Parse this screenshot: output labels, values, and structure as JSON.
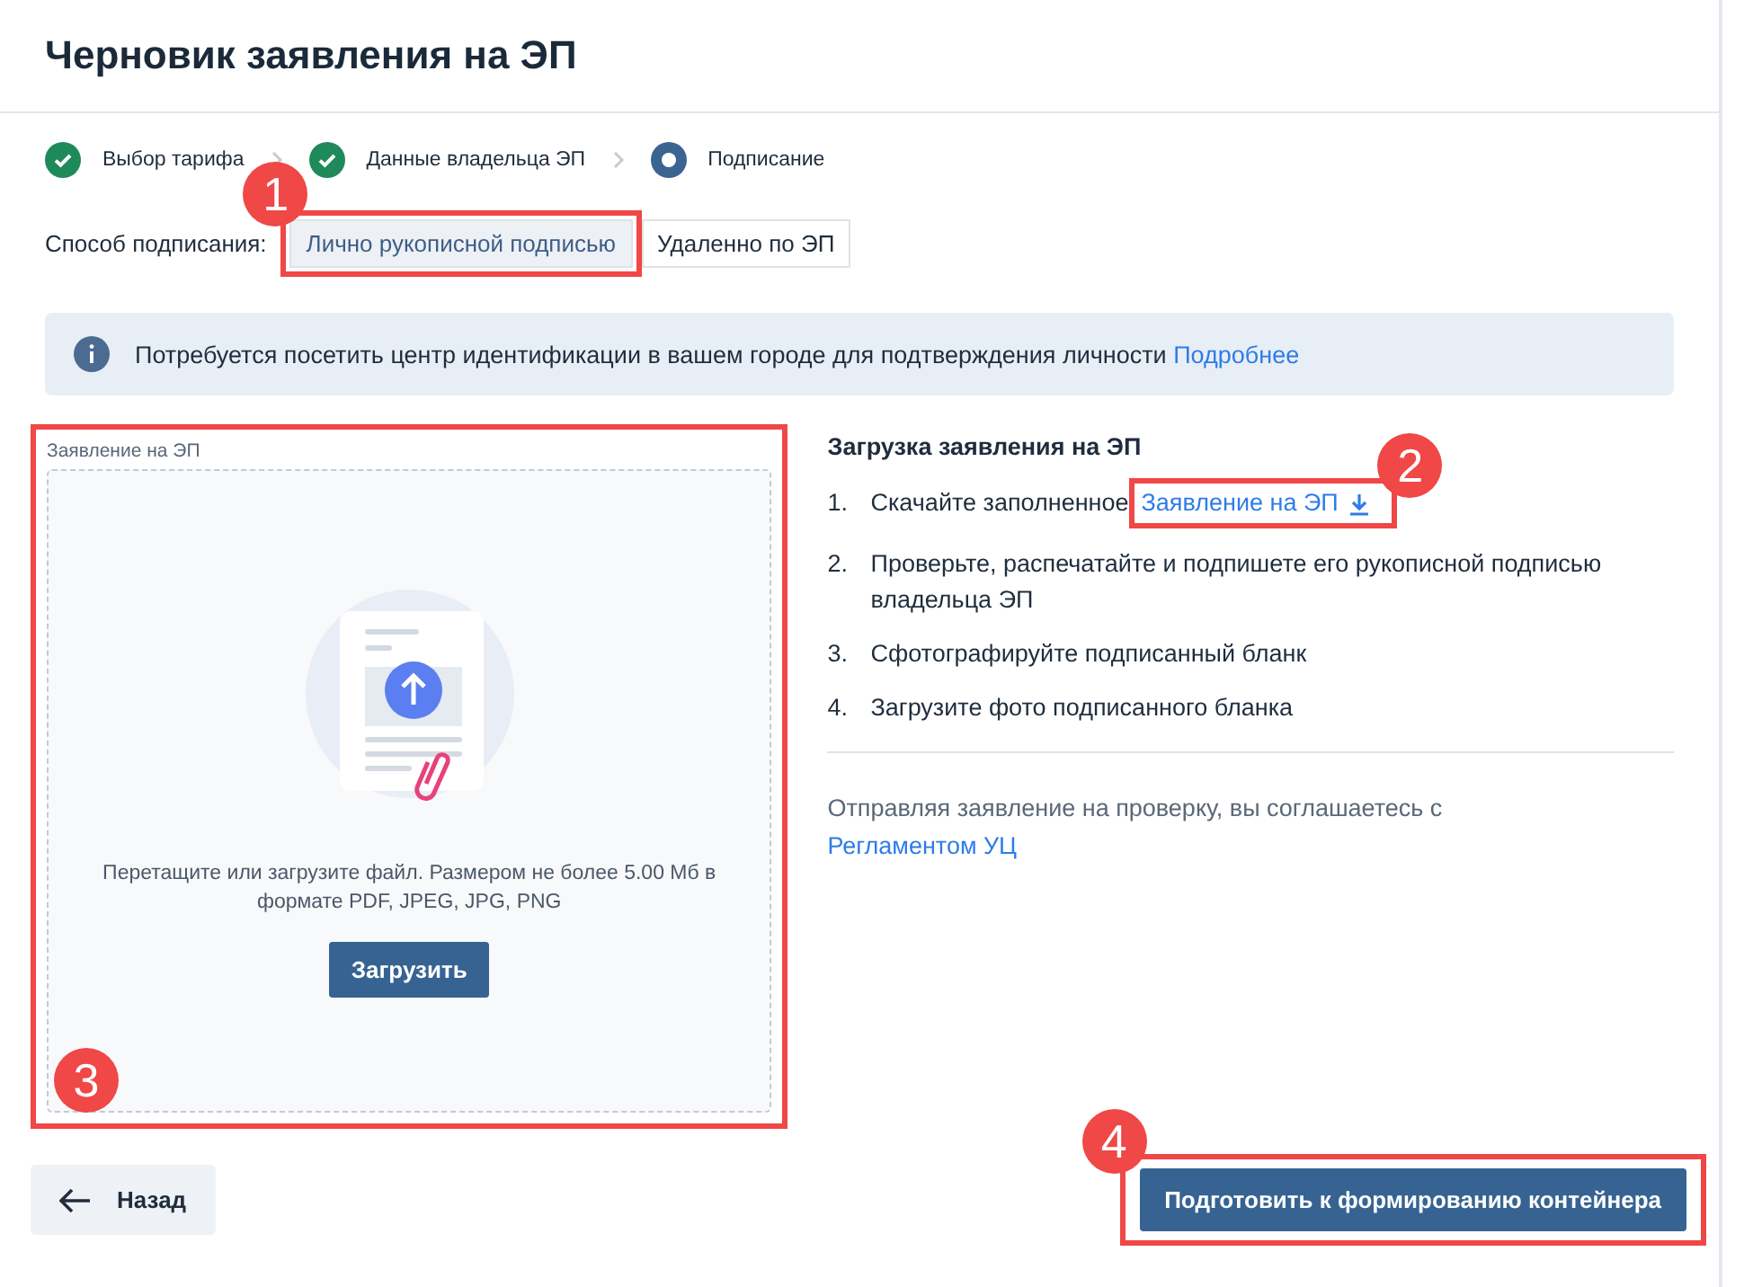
{
  "title": "Черновик заявления на ЭП",
  "steps": [
    {
      "label": "Выбор тарифа",
      "completed": true
    },
    {
      "label": "Данные владельца ЭП",
      "completed": true
    },
    {
      "label": "Подписание",
      "completed": false
    }
  ],
  "signing_method": {
    "label": "Способ подписания:",
    "callout": "1",
    "options": [
      {
        "label": "Лично рукописной подписью",
        "selected": true
      },
      {
        "label": "Удаленно по ЭП",
        "selected": false
      }
    ]
  },
  "info_banner": {
    "text": "Потребуется посетить центр идентификации в вашем городе для подтверждения личности",
    "link": "Подробнее"
  },
  "upload": {
    "label": "Заявление на ЭП",
    "callout": "3",
    "hint": "Перетащите или загрузите файл. Размером не более 5.00 Мб в формате PDF, JPEG, JPG, PNG",
    "button": "Загрузить"
  },
  "instructions": {
    "title": "Загрузка заявления на ЭП",
    "steps": [
      {
        "number": "1.",
        "text": "Скачайте заполненное",
        "link": "Заявление на ЭП",
        "callout": "2"
      },
      {
        "number": "2.",
        "text": "Проверьте, распечатайте и подпишете его рукописной подписью владельца ЭП"
      },
      {
        "number": "3.",
        "text": "Сфотографируйте подписанный бланк"
      },
      {
        "number": "4.",
        "text": "Загрузите фото подписанного бланка"
      }
    ],
    "agreement": "Отправляя заявление на проверку, вы соглашаетесь с",
    "agreement_link": "Регламентом УЦ"
  },
  "footer": {
    "back": "Назад",
    "submit": "Подготовить к формированию контейнера",
    "submit_callout": "4"
  }
}
